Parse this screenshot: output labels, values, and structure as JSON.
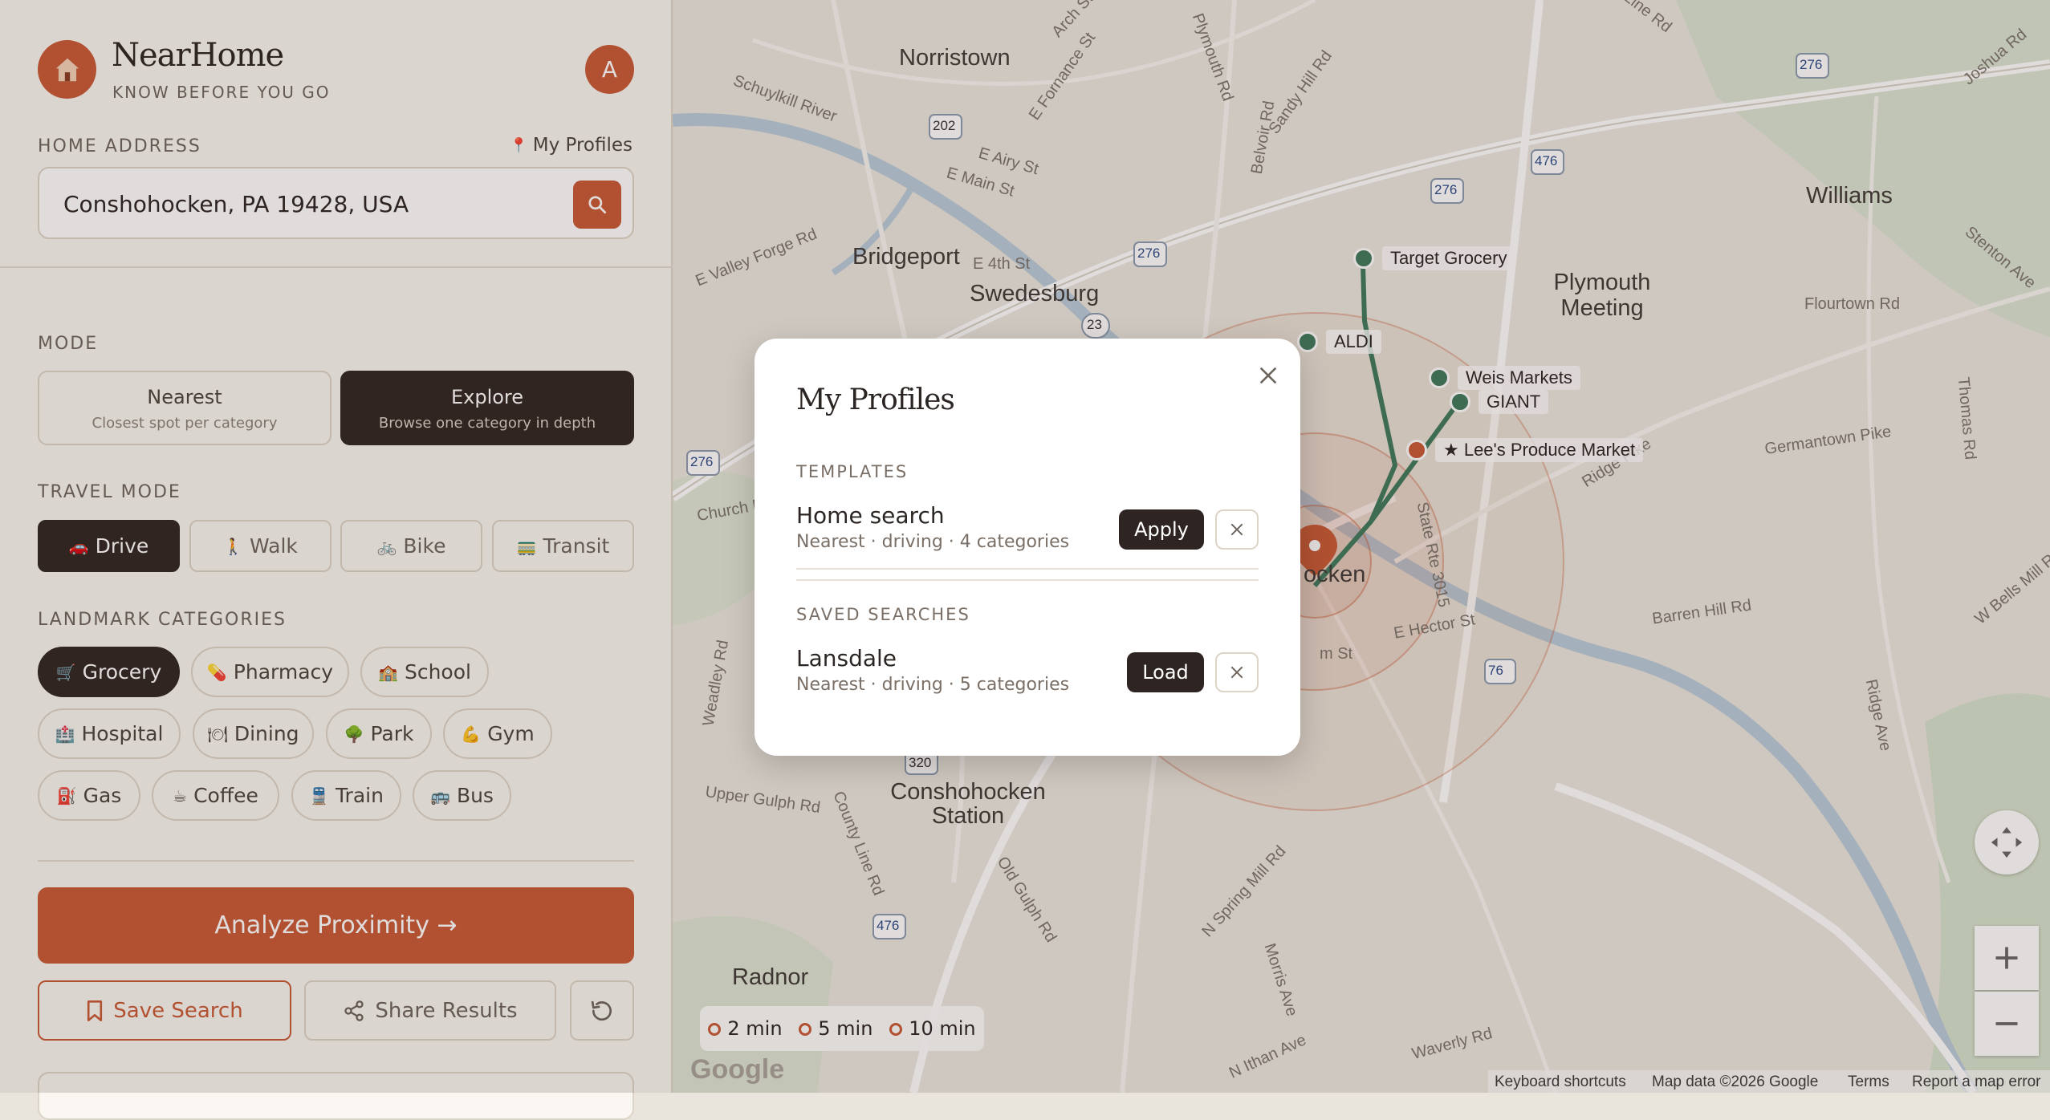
{
  "app": {
    "name": "NearHome",
    "tagline": "KNOW BEFORE YOU GO",
    "avatar_initial": "A",
    "accent_color": "#c85a35",
    "dark_color": "#2e2522"
  },
  "home_address": {
    "label": "HOME ADDRESS",
    "profiles_link": "My Profiles",
    "value": "Conshohocken, PA 19428, USA"
  },
  "mode": {
    "label": "MODE",
    "options": [
      {
        "title": "Nearest",
        "subtitle": "Closest spot per category",
        "active": false
      },
      {
        "title": "Explore",
        "subtitle": "Browse one category in depth",
        "active": true
      }
    ]
  },
  "travel_mode": {
    "label": "TRAVEL MODE",
    "options": [
      {
        "label": "Drive",
        "icon": "🚗",
        "active": true
      },
      {
        "label": "Walk",
        "icon": "🚶",
        "active": false
      },
      {
        "label": "Bike",
        "icon": "🚲",
        "active": false
      },
      {
        "label": "Transit",
        "icon": "🚃",
        "active": false
      }
    ]
  },
  "categories": {
    "label": "LANDMARK CATEGORIES",
    "items": [
      {
        "label": "Grocery",
        "icon": "🛒",
        "active": true
      },
      {
        "label": "Pharmacy",
        "icon": "💊",
        "active": false
      },
      {
        "label": "School",
        "icon": "🏫",
        "active": false
      },
      {
        "label": "Hospital",
        "icon": "🏥",
        "active": false
      },
      {
        "label": "Dining",
        "icon": "🍽",
        "active": false
      },
      {
        "label": "Park",
        "icon": "🌳",
        "active": false
      },
      {
        "label": "Gym",
        "icon": "💪",
        "active": false
      },
      {
        "label": "Gas",
        "icon": "⛽",
        "active": false
      },
      {
        "label": "Coffee",
        "icon": "☕",
        "active": false
      },
      {
        "label": "Train",
        "icon": "🚆",
        "active": false
      },
      {
        "label": "Bus",
        "icon": "🚌",
        "active": false
      }
    ]
  },
  "actions": {
    "analyze": "Analyze Proximity →",
    "save": "Save Search",
    "share": "Share Results"
  },
  "map": {
    "places": [
      "Norristown",
      "Bridgeport",
      "Swedesburg",
      "Plymouth Meeting",
      "Williams",
      "Conshohocken Station",
      "Radnor"
    ],
    "streets": [
      "E Airy St",
      "E Main St",
      "E 4th St",
      "E Valley Forge Rd",
      "Schuylkill River",
      "Sandy Hill Rd",
      "Plymouth Rd",
      "Belvoir Rd",
      "Flourtown Rd",
      "Germantown Pike",
      "Ridge Pike",
      "Barren Hill Rd",
      "E Hector St",
      "State Rte 3015",
      "Old Gulph Rd",
      "N Spring Mill Rd",
      "Morris Ave",
      "N Ithan Ave",
      "Waverly Rd",
      "Church Rd",
      "Upper Gulph Rd",
      "County Line Rd",
      "Weadley Rd",
      "Ridge Ave",
      "Thomas Rd",
      "Stenton Ave",
      "W Bells Mill Rd",
      "Joshua Rd",
      "Line Rd",
      "Arch St",
      "E Fornance St"
    ],
    "route_shields": [
      "202",
      "276",
      "276",
      "276",
      "476",
      "276",
      "23",
      "276",
      "76",
      "320",
      "476"
    ],
    "pois": [
      {
        "label": "Target Grocery",
        "highlight": false
      },
      {
        "label": "ALDI",
        "highlight": false
      },
      {
        "label": "Weis Markets",
        "highlight": false
      },
      {
        "label": "GIANT",
        "highlight": false
      },
      {
        "label": "★ Lee's Produce Market",
        "highlight": true
      }
    ],
    "partial_label": "ocken",
    "partial_street": "m St",
    "legend": [
      "2 min",
      "5 min",
      "10 min"
    ],
    "attribution": {
      "keyboard": "Keyboard shortcuts",
      "data": "Map data ©2026 Google",
      "terms": "Terms",
      "report": "Report a map error"
    },
    "google": "Google"
  },
  "modal": {
    "title": "My Profiles",
    "templates_label": "TEMPLATES",
    "templates": [
      {
        "name": "Home search",
        "meta": "Nearest · driving · 4 categories",
        "action": "Apply"
      }
    ],
    "saved_label": "SAVED SEARCHES",
    "saved": [
      {
        "name": "Lansdale",
        "meta": "Nearest · driving · 5 categories",
        "action": "Load"
      }
    ]
  }
}
